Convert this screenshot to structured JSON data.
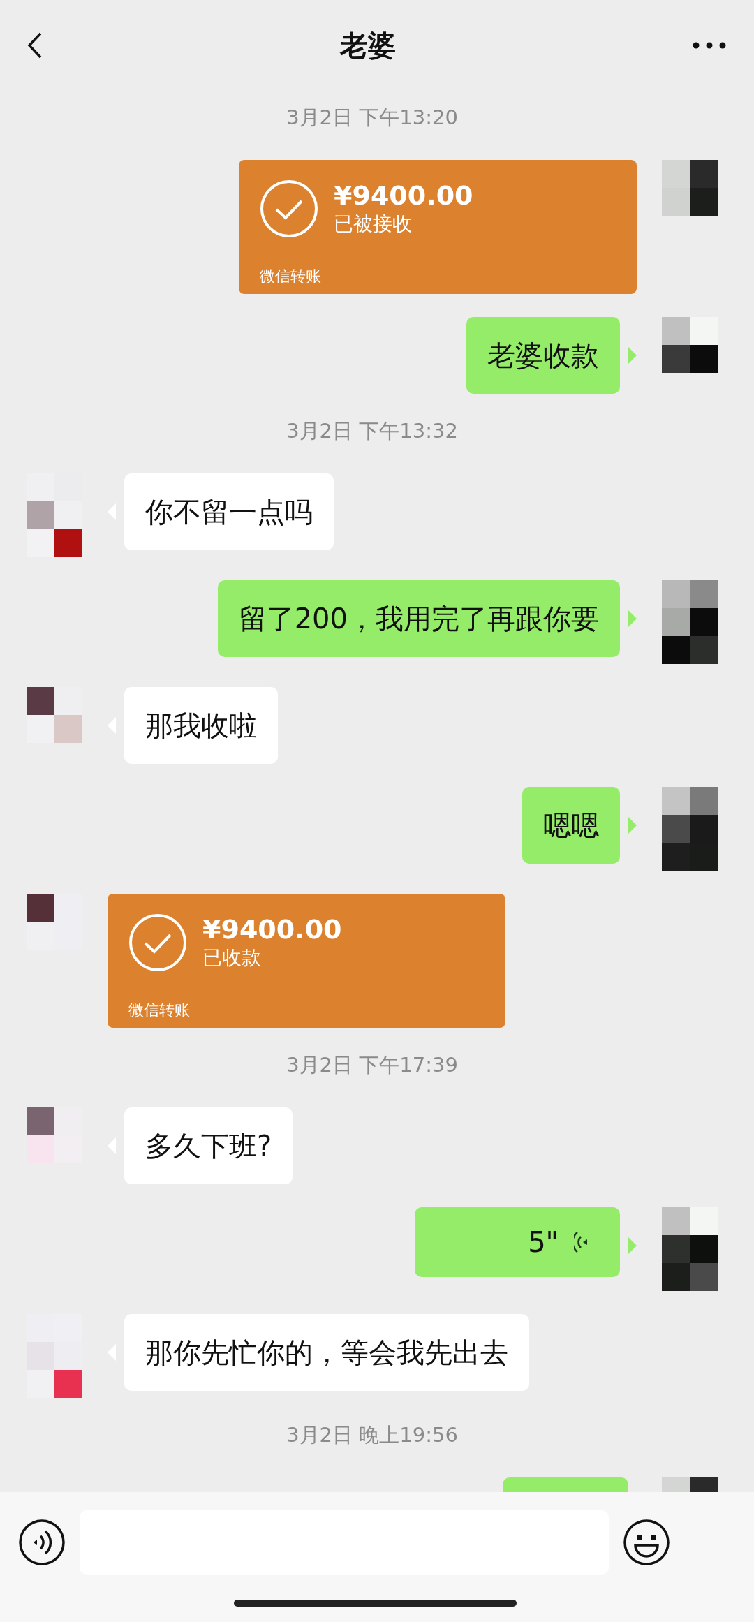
{
  "header": {
    "title": "老婆"
  },
  "messages": [
    {
      "kind": "time",
      "text": "3月2日 下午13:20"
    },
    {
      "kind": "transfer",
      "outgoing": true,
      "amount": "¥9400.00",
      "status": "已被接收",
      "footer": "微信转账"
    },
    {
      "kind": "text",
      "outgoing": true,
      "text": "老婆收款"
    },
    {
      "kind": "time",
      "text": "3月2日 下午13:32"
    },
    {
      "kind": "text",
      "outgoing": false,
      "text": "你不留一点吗"
    },
    {
      "kind": "text",
      "outgoing": true,
      "text": "留了200，我用完了再跟你要"
    },
    {
      "kind": "text",
      "outgoing": false,
      "text": "那我收啦"
    },
    {
      "kind": "text",
      "outgoing": true,
      "text": "嗯嗯"
    },
    {
      "kind": "transfer",
      "outgoing": false,
      "amount": "¥9400.00",
      "status": "已收款",
      "footer": "微信转账"
    },
    {
      "kind": "time",
      "text": "3月2日 下午17:39"
    },
    {
      "kind": "text",
      "outgoing": false,
      "text": "多久下班?"
    },
    {
      "kind": "voice",
      "outgoing": true,
      "duration": "5\""
    },
    {
      "kind": "text",
      "outgoing": false,
      "text": "那你先忙你的，等会我先出去"
    },
    {
      "kind": "time",
      "text": "3月2日 晚上19:56"
    },
    {
      "kind": "cut",
      "outgoing": true
    }
  ]
}
